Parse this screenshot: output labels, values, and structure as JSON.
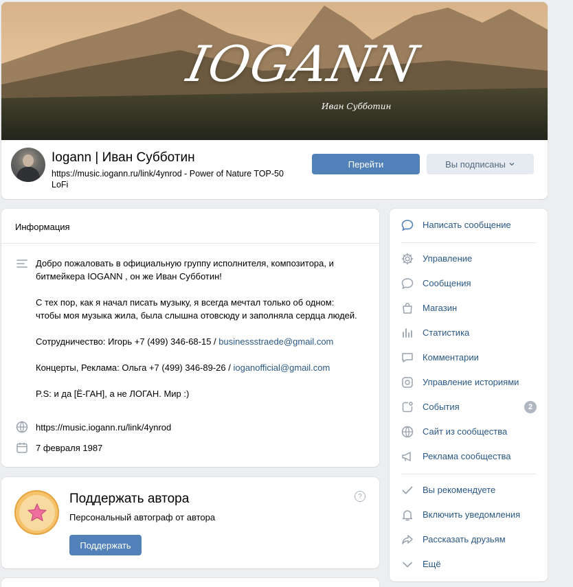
{
  "header": {
    "cover_title": "IOGANN",
    "cover_subtitle": "Иван Субботин",
    "group_name": "Iogann | Иван Субботин",
    "status": "https://music.iogann.ru/link/4ynrod - Power of Nature TOP-50 LoFi",
    "go_button": "Перейти",
    "subscribed_button": "Вы подписаны"
  },
  "info": {
    "title": "Информация",
    "description": {
      "p1": "Добро пожаловать в официальную группу исполнителя, композитора, и битмейкера IOGANN , он же Иван Субботин!",
      "p2": "С тех пор, как я начал писать музыку, я всегда мечтал только об одном: чтобы моя музыка жила, была слышна отовсюду и заполняла сердца людей.",
      "p3_prefix": "Сотрудничество: Игорь +7 (499) 346-68-15 / ",
      "p3_email": "businessstraede@gmail.com",
      "p4_prefix": "Концерты, Реклама: Ольга +7 (499) 346-89-26 / ",
      "p4_email": "ioganofficial@gmail.com",
      "p5": "P.S: и да [Ё-ГАН], а не ЛОГАН. Мир :)"
    },
    "website": "https://music.iogann.ru/link/4ynrod",
    "date": "7 февраля 1987"
  },
  "support": {
    "title": "Поддержать автора",
    "subtitle": "Персональный автограф от автора",
    "button": "Поддержать",
    "help": "?"
  },
  "menu": {
    "write_message": "Написать сообщение",
    "manage": "Управление",
    "messages": "Сообщения",
    "shop": "Магазин",
    "stats": "Статистика",
    "comments": "Комментарии",
    "stories": "Управление историями",
    "events": "События",
    "events_count": "2",
    "site": "Сайт из сообщества",
    "ads": "Реклама сообщества",
    "recommend": "Вы рекомендуете",
    "notifications": "Включить уведомления",
    "share": "Рассказать друзьям",
    "more": "Ещё"
  },
  "colors": {
    "accent": "#5181b8",
    "link": "#2a5885",
    "background": "#edeef0",
    "icon": "#99a2ad"
  }
}
